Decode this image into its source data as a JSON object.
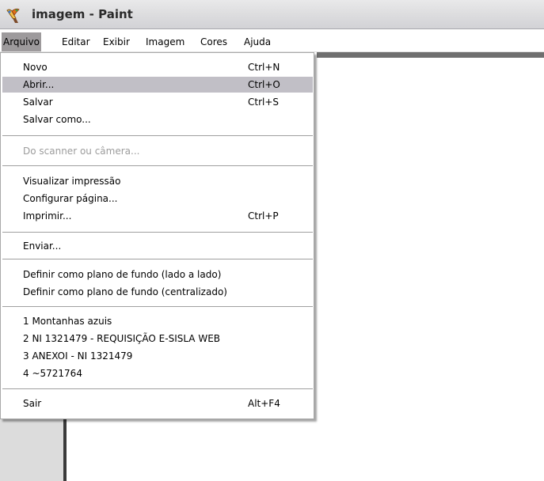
{
  "window": {
    "title": "imagem - Paint",
    "icon": "paint-brush-icon"
  },
  "menubar": {
    "items": [
      {
        "label": "Arquivo",
        "active": true
      },
      {
        "label": "Editar"
      },
      {
        "label": "Exibir"
      },
      {
        "label": "Imagem"
      },
      {
        "label": "Cores"
      },
      {
        "label": "Ajuda"
      }
    ]
  },
  "file_menu": {
    "items": [
      {
        "label": "Novo",
        "shortcut": "Ctrl+N"
      },
      {
        "label": "Abrir...",
        "shortcut": "Ctrl+O",
        "highlighted": true
      },
      {
        "label": "Salvar",
        "shortcut": "Ctrl+S"
      },
      {
        "label": "Salvar como...",
        "shortcut": ""
      },
      {
        "label": "Do scanner ou câmera...",
        "shortcut": "",
        "disabled": true
      },
      {
        "label": "Visualizar impressão",
        "shortcut": ""
      },
      {
        "label": "Configurar página...",
        "shortcut": ""
      },
      {
        "label": "Imprimir...",
        "shortcut": "Ctrl+P"
      },
      {
        "label": "Enviar...",
        "shortcut": ""
      },
      {
        "label": "Definir como plano de fundo (lado a lado)",
        "shortcut": ""
      },
      {
        "label": "Definir como plano de fundo (centralizado)",
        "shortcut": ""
      },
      {
        "label": "1 Montanhas azuis",
        "shortcut": ""
      },
      {
        "label": "2 NI 1321479 - REQUISIÇÃO E-SISLA WEB",
        "shortcut": ""
      },
      {
        "label": "3 ANEXOI - NI 1321479",
        "shortcut": ""
      },
      {
        "label": "4 ~5721764",
        "shortcut": ""
      },
      {
        "label": "Sair",
        "shortcut": "Alt+F4"
      }
    ]
  },
  "colors": {
    "highlight": "#c1bfc6",
    "menubar_active": "#9d9a9c",
    "disabled_text": "#9c9c9c"
  }
}
